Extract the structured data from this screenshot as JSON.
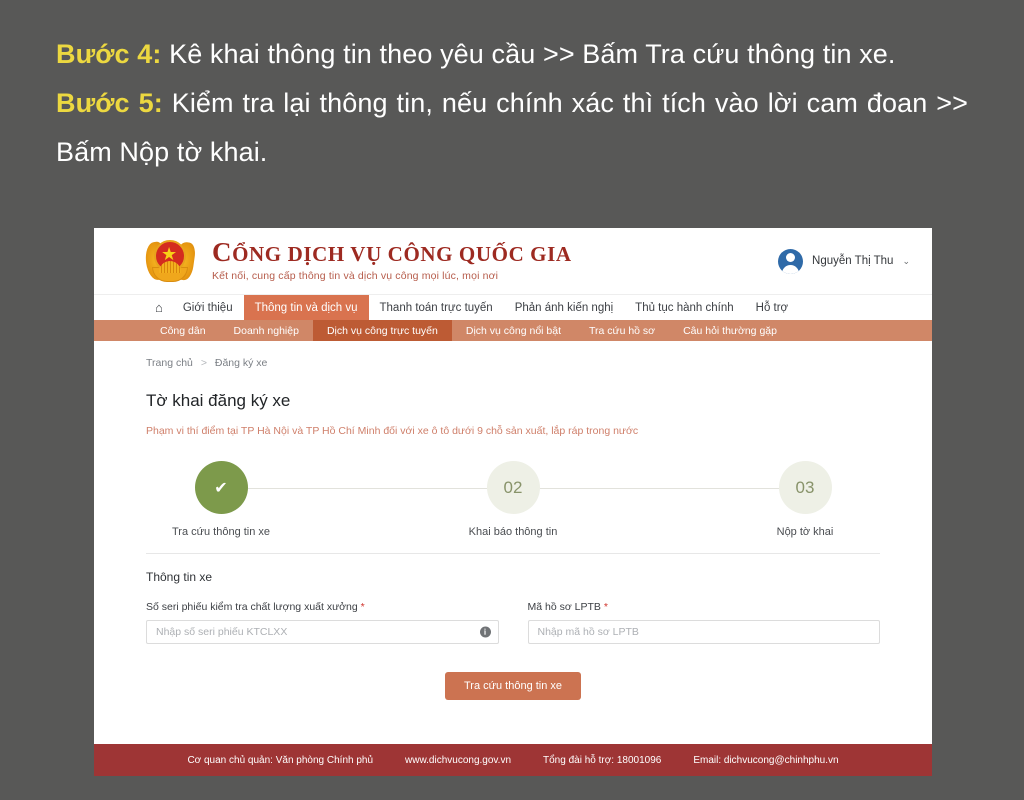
{
  "slide": {
    "lines": [
      {
        "label": "Bước 4:",
        "text": " Kê khai thông tin theo yêu cầu >> Bấm Tra cứu thông tin xe."
      },
      {
        "label": "Bước 5:",
        "text": " Kiểm tra lại thông tin, nếu chính xác thì tích vào lời cam đoan >> Bấm Nộp tờ khai."
      }
    ],
    "background_color": "#585857",
    "label_color": "#ecd840",
    "text_color": "#ffffff"
  },
  "site": {
    "header": {
      "emblem_icon": "vietnam-national-emblem-icon",
      "brand_title_first": "C",
      "brand_title_rest": "ổng dịch vụ công quốc gia",
      "brand_subtitle": "Kết nối, cung cấp thông tin và dịch vụ công mọi lúc, mọi nơi",
      "user_name": "Nguyễn Thị Thu",
      "user_caret": "⌄",
      "avatar_icon": "user-avatar-icon"
    },
    "nav_main": {
      "home_icon": "⌂",
      "items": [
        {
          "label": "Giới thiệu",
          "active": false
        },
        {
          "label": "Thông tin và dịch vụ",
          "active": true
        },
        {
          "label": "Thanh toán trực tuyến",
          "active": false
        },
        {
          "label": "Phản ánh kiến nghị",
          "active": false
        },
        {
          "label": "Thủ tục hành chính",
          "active": false
        },
        {
          "label": "Hỗ trợ",
          "active": false
        }
      ],
      "active_color": "#d9734f"
    },
    "nav_sub": {
      "background_color": "#d08767",
      "active_color": "#bd5b34",
      "items": [
        {
          "label": "Công dân",
          "active": false
        },
        {
          "label": "Doanh nghiệp",
          "active": false
        },
        {
          "label": "Dịch vụ công trực tuyến",
          "active": true
        },
        {
          "label": "Dịch vụ công nổi bật",
          "active": false
        },
        {
          "label": "Tra cứu hồ sơ",
          "active": false
        },
        {
          "label": "Câu hỏi thường gặp",
          "active": false
        }
      ]
    },
    "breadcrumb": {
      "home": "Trang chủ",
      "separator": ">",
      "current": "Đăng ký xe"
    },
    "page_title": "Tờ khai đăng ký xe",
    "page_note": "Phạm vi thí điểm tại TP Hà Nội và TP Hồ Chí Minh đối với xe ô tô dưới 9 chỗ sản xuất, lắp ráp trong nước",
    "stepper": {
      "done_color": "#7d9a4b",
      "todo_color": "#eef0e6",
      "steps": [
        {
          "badge": "✔",
          "caption": "Tra cứu thông tin xe",
          "state": "done"
        },
        {
          "badge": "02",
          "caption": "Khai báo thông tin",
          "state": "todo"
        },
        {
          "badge": "03",
          "caption": "Nộp tờ khai",
          "state": "todo"
        }
      ]
    },
    "form": {
      "section_title": "Thông tin xe",
      "required_marker": "*",
      "fields": [
        {
          "label": "Số seri phiếu kiểm tra chất lượng xuất xưởng",
          "placeholder": "Nhập số seri phiếu KTCLXX",
          "value": "",
          "required": true,
          "info_icon": "info-circle-icon"
        },
        {
          "label": "Mã hồ sơ LPTB",
          "placeholder": "Nhập mã hồ sơ LPTB",
          "value": "",
          "required": true
        }
      ],
      "submit_label": "Tra cứu thông tin xe",
      "submit_color": "#cc7351"
    },
    "footer": {
      "background_color": "#9e3535",
      "items": [
        "Cơ quan chủ quản: Văn phòng Chính phủ",
        "www.dichvucong.gov.vn",
        "Tổng đài hỗ trợ: 18001096",
        "Email: dichvucong@chinhphu.vn"
      ]
    }
  }
}
